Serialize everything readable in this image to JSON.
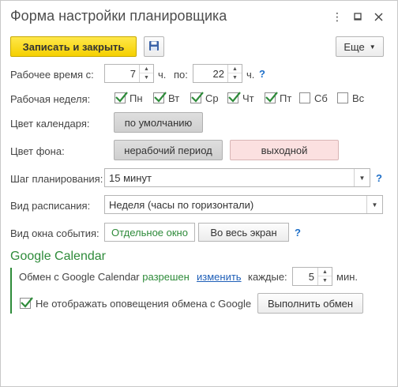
{
  "window": {
    "title": "Форма настройки планировщика",
    "menu_icon": "more-vertical-icon",
    "minimize_icon": "minimize-icon",
    "maximize_icon": "maximize-icon",
    "close_icon": "close-icon"
  },
  "toolbar": {
    "save_close_label": "Записать и закрыть",
    "save_icon": "floppy-disk-icon",
    "more_label": "Еще"
  },
  "work_time": {
    "label": "Рабочее время с:",
    "from_value": "7",
    "from_unit": "ч.",
    "to_label": "по:",
    "to_value": "22",
    "to_unit": "ч.",
    "help": "?"
  },
  "work_week": {
    "label": "Рабочая неделя:",
    "days": [
      {
        "label": "Пн",
        "checked": true
      },
      {
        "label": "Вт",
        "checked": true
      },
      {
        "label": "Ср",
        "checked": true
      },
      {
        "label": "Чт",
        "checked": true
      },
      {
        "label": "Пт",
        "checked": true
      },
      {
        "label": "Сб",
        "checked": false
      },
      {
        "label": "Вс",
        "checked": false
      }
    ]
  },
  "calendar_color": {
    "label": "Цвет календаря:",
    "button": "по умолчанию"
  },
  "background_color": {
    "label": "Цвет фона:",
    "nonworking_button": "нерабочий период",
    "dayoff_button": "выходной"
  },
  "planning_step": {
    "label": "Шаг планирования:",
    "value": "15 минут",
    "help": "?"
  },
  "schedule_view": {
    "label": "Вид расписания:",
    "value": "Неделя (часы по горизонтали)"
  },
  "event_window": {
    "label": "Вид окна события:",
    "option_separate": "Отдельное окно",
    "option_fullscreen": "Во весь экран",
    "help": "?"
  },
  "google": {
    "section_title": "Google Calendar",
    "exchange_prefix": "Обмен с Google Calendar",
    "exchange_status": "разрешен",
    "change_link": "изменить",
    "every_label": "каждые:",
    "interval_value": "5",
    "interval_unit": "мин.",
    "no_notify_label": "Не отображать оповещения обмена с Google",
    "no_notify_checked": true,
    "run_button": "Выполнить обмен"
  },
  "colors": {
    "primary_yellow": "#f5d000",
    "green": "#2e8b3a",
    "link_blue": "#1f5fb8",
    "dayoff_pink": "#fbe0e0"
  }
}
